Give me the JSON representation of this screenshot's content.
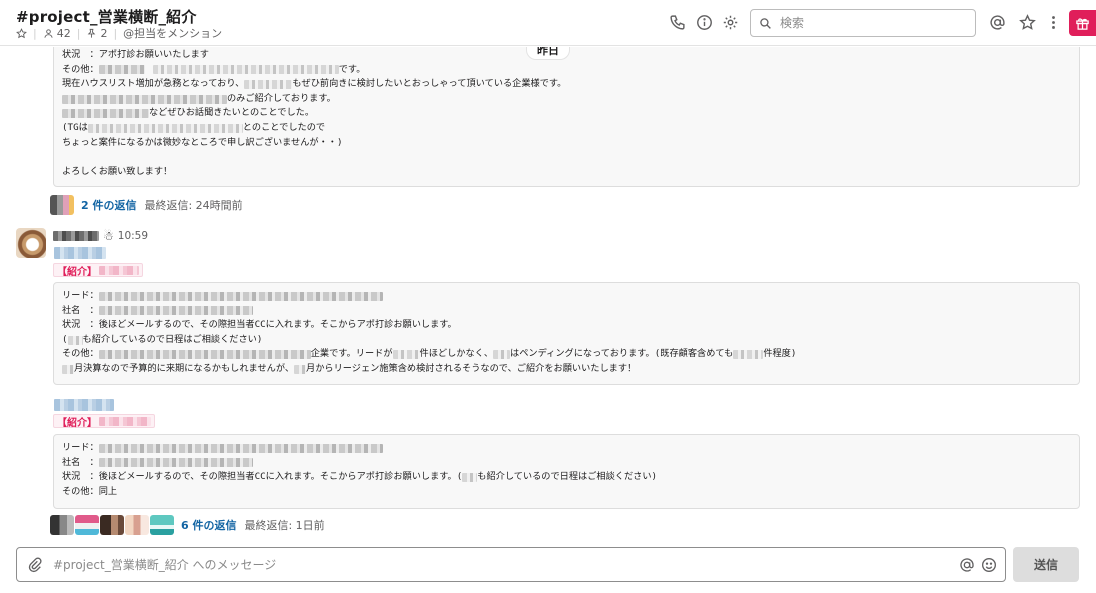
{
  "header": {
    "channel_name": "#project_営業横断_紹介",
    "member_count": "42",
    "pinned_count": "2",
    "topic": "@担当をメンション",
    "search_placeholder": "検索"
  },
  "day_divider": "昨日",
  "message1": {
    "lines": [
      {
        "label": "状況　：",
        "text": "アポ打診お願いいたします"
      },
      {
        "label": "その他：",
        "text_after": "です。"
      },
      {
        "text": "現在ハウスリスト増加が急務となっており、",
        "text_after": "もぜひ前向きに検討したいとおっしゃって頂いている企業様です。"
      },
      {
        "text_after": "のみご紹介しております。"
      },
      {
        "text_after": "などぜひお話聞きたいとのことでした。"
      },
      {
        "text": "(TGは",
        "text_after": "とのことでしたので"
      },
      {
        "text": "ちょっと案件になるかは微妙なところで申し訳ございませんが・・)"
      },
      {
        "text": ""
      },
      {
        "text": "よろしくお願い致します！"
      }
    ],
    "thread": {
      "replies": "2 件の返信",
      "last_reply": "最終返信: 24時間前"
    }
  },
  "message2": {
    "time": "10:59",
    "snow_icon": "☃",
    "block1": {
      "tag": "【紹介】",
      "lines": [
        {
          "label": "リード："
        },
        {
          "label": "社名　："
        },
        {
          "label": "状況　：",
          "text": "後ほどメールするので、その際担当者CCに入れます。そこからアポ打診お願いします。"
        },
        {
          "text": "(",
          "text_after": "も紹介しているので日程はご相談ください)"
        },
        {
          "label": "その他：",
          "text_after": "企業です。リードが",
          "text_after2": "件ほどしかなく、",
          "text_after3": "はペンディングになっております。(既存顧客含めても",
          "text_after4": "件程度)"
        },
        {
          "text_after": "月決算なので予算的に来期になるかもしれませんが、",
          "text_after2": "月からリージェン施策含め検討されるそうなので、ご紹介をお願いいたします！"
        }
      ]
    },
    "block2": {
      "tag": "【紹介】",
      "lines": [
        {
          "label": "リード："
        },
        {
          "label": "社名　："
        },
        {
          "label": "状況　：",
          "text": "後ほどメールするので、その際担当者CCに入れます。そこからアポ打診お願いします。(",
          "text_after": "も紹介しているので日程はご相談ください)"
        },
        {
          "label": "その他：",
          "text": "同上"
        }
      ]
    },
    "thread": {
      "replies": "6 件の返信",
      "last_reply": "最終返信: 1日前"
    }
  },
  "composer": {
    "placeholder": "#project_営業横断_紹介 へのメッセージ",
    "send_label": "送信"
  },
  "colors": {
    "accent_pink": "#e01e5a",
    "link_blue": "#1264a3"
  },
  "icons": [
    "star-icon",
    "person-icon",
    "pin-icon",
    "phone-icon",
    "info-icon",
    "gear-icon",
    "search-icon",
    "at-icon",
    "star-icon",
    "more-icon",
    "gift-icon",
    "paperclip-icon",
    "emoji-icon"
  ]
}
